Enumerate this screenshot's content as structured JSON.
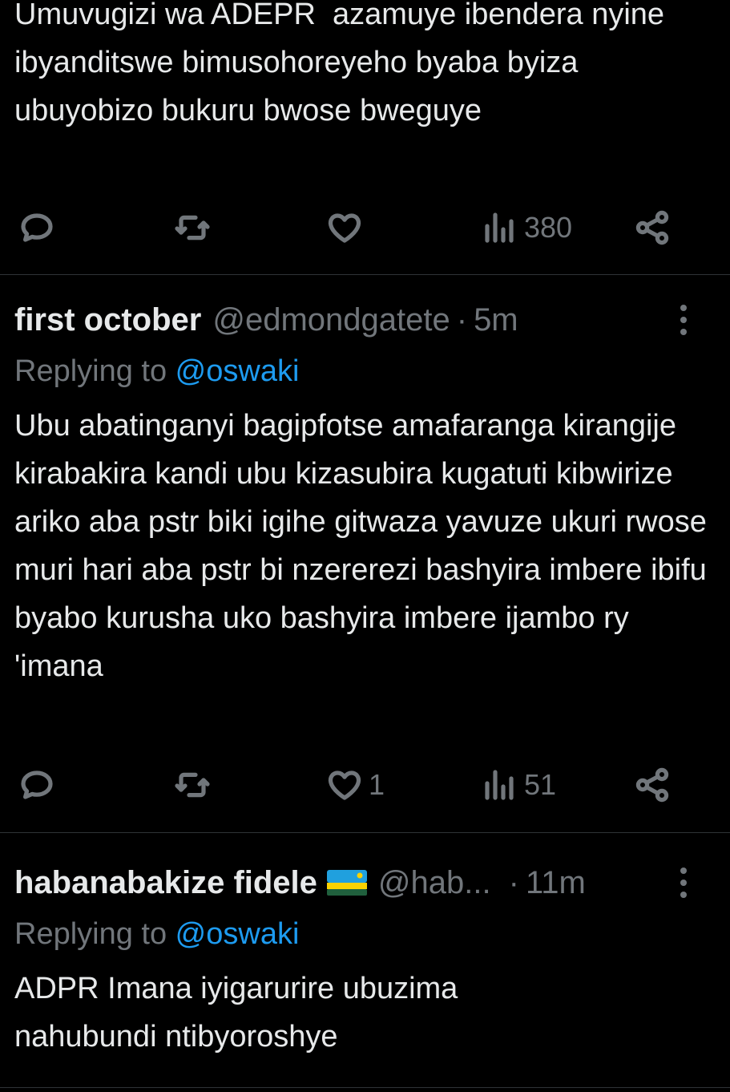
{
  "tweets": [
    {
      "text": "Umuvugizi wa ADEPR  azamuye ibendera nyine ibyanditswe bimusohoreyeho byaba byiza ubuyobizo bukuru bwose bweguye",
      "actions": {
        "replies": "",
        "retweets": "",
        "likes": "",
        "views": "380"
      }
    },
    {
      "name": "first october",
      "handle": "@edmondgatete",
      "separator": "·",
      "time": "5m",
      "replying_prefix": "Replying to ",
      "replying_to": "@oswaki",
      "text": "Ubu abatinganyi bagipfotse amafaranga kirangije kirabakira kandi ubu kizasubira kugatuti kibwirize ariko aba pstr biki igihe gitwaza yavuze ukuri rwose muri hari aba pstr bi nzererezi bashyira imbere ibifu byabo kurusha uko bashyira imbere ijambo ry 'imana",
      "actions": {
        "replies": "",
        "retweets": "",
        "likes": "1",
        "views": "51"
      }
    },
    {
      "name": "habanabakize fidele",
      "flag": "rwanda-flag-icon",
      "handle": "@hab...",
      "separator": "·",
      "time": "11m",
      "replying_prefix": "Replying to ",
      "replying_to": "@oswaki",
      "text": "ADPR Imana iyigarurire ubuzima nahubundi ntibyoroshye"
    }
  ],
  "icons": {
    "reply": "reply-icon",
    "retweet": "retweet-icon",
    "like": "heart-icon",
    "views": "views-icon",
    "share": "share-icon",
    "more": "more-icon"
  },
  "colors": {
    "background": "#000000",
    "text": "#e7e9ea",
    "muted": "#71767b",
    "link": "#1d9bf0",
    "divider": "#2f3336"
  }
}
